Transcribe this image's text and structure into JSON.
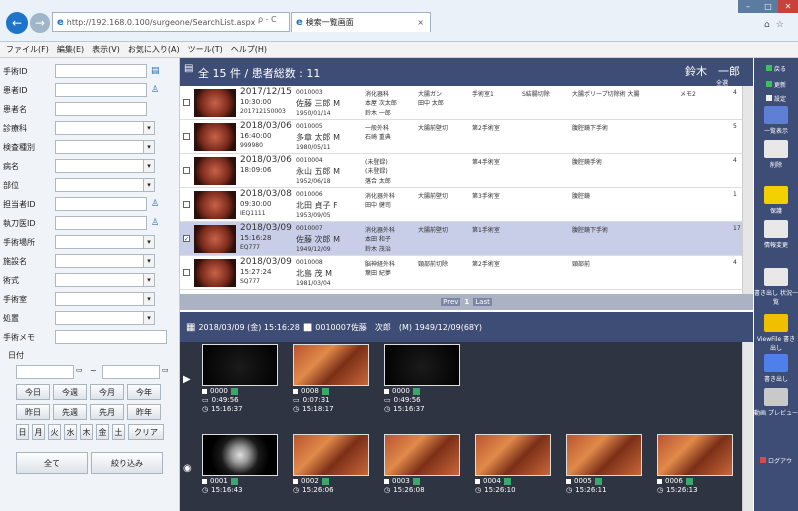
{
  "browser": {
    "url": "http://192.168.0.100/surgeone/SearchList.aspx",
    "addr_controls": "ρ - C",
    "tab_title": "検索一覧画面",
    "tab_close": "×"
  },
  "menu": [
    "ファイル(F)",
    "編集(E)",
    "表示(V)",
    "お気に入り(A)",
    "ツール(T)",
    "ヘルプ(H)"
  ],
  "search_form": {
    "fields": [
      {
        "label": "手術ID",
        "kind": "input",
        "icon": "search-list-icon"
      },
      {
        "label": "患者ID",
        "kind": "input",
        "icon": "person-icon"
      },
      {
        "label": "患者名",
        "kind": "input"
      },
      {
        "label": "診療科",
        "kind": "select"
      },
      {
        "label": "検査種別",
        "kind": "select"
      },
      {
        "label": "病名",
        "kind": "select"
      },
      {
        "label": "部位",
        "kind": "select"
      },
      {
        "label": "担当者ID",
        "kind": "input",
        "icon": "person-icon"
      },
      {
        "label": "執刀医ID",
        "kind": "input",
        "icon": "person-icon"
      },
      {
        "label": "手術場所",
        "kind": "select"
      },
      {
        "label": "施設名",
        "kind": "select"
      },
      {
        "label": "術式",
        "kind": "select"
      },
      {
        "label": "手術室",
        "kind": "select"
      },
      {
        "label": "処置",
        "kind": "select"
      },
      {
        "label": "手術メモ",
        "kind": "input"
      }
    ],
    "date_label": "日付",
    "date_sep": "~",
    "range_buttons": [
      "今日",
      "今週",
      "今月",
      "今年",
      "昨日",
      "先週",
      "先月",
      "昨年"
    ],
    "weekday_buttons": [
      "日",
      "月",
      "火",
      "水",
      "木",
      "金",
      "土"
    ],
    "clear_button": "クリア",
    "all_button": "全て",
    "filter_button": "絞り込み"
  },
  "list": {
    "summary": "全 15 件 / 患者総数 : 11",
    "user": "鈴木　一郎",
    "all_select": "全選",
    "rows": [
      {
        "date": "2017/12/15",
        "time": "10:30:00",
        "code": "201712150003",
        "pid": "0010003",
        "name": "佐藤 三郎 M",
        "dob": "1950/01/14",
        "dept": "消化器科",
        "s1": "本屋 次太郎",
        "s2": "鈴木 一郎",
        "c1": "大腸ガン",
        "c2": "田中 太郎",
        "c3": "手術室1",
        "c4": "S結腸切除",
        "c5": "大腸ポリープ切除術 大腸",
        "c6": "メモ2",
        "n": "4",
        "checked": false,
        "selected": false
      },
      {
        "date": "2018/03/06",
        "time": "16:40:00",
        "code": "999980",
        "pid": "0010005",
        "name": "多章 太郎 M",
        "dob": "1980/05/11",
        "dept": "一般外科",
        "s1": "石崎 重典",
        "s2": "",
        "c1": "大腸前壁切",
        "c2": "",
        "c3": "第2手術室",
        "c4": "",
        "c5": "腹腔鏡下手術",
        "c6": "",
        "n": "5",
        "checked": false,
        "selected": false
      },
      {
        "date": "2018/03/06",
        "time": "18:09:06",
        "code": "",
        "pid": "0010004",
        "name": "永山 五郎 M",
        "dob": "1952/06/18",
        "dept": "(未登録)",
        "s1": "(未登録)",
        "s2": "落合 太郎",
        "c1": "",
        "c2": "",
        "c3": "第4手術室",
        "c4": "",
        "c5": "腹腔鏡手術",
        "c6": "",
        "n": "4",
        "checked": false,
        "selected": false
      },
      {
        "date": "2018/03/08",
        "time": "09:30:00",
        "code": "IEQ1111",
        "pid": "0010006",
        "name": "北田 貞子 F",
        "dob": "1953/09/05",
        "dept": "消化器外科",
        "s1": "田中 健司",
        "s2": "",
        "c1": "大腸前壁切",
        "c2": "",
        "c3": "第3手術室",
        "c4": "",
        "c5": "腹腔鏡",
        "c6": "",
        "n": "1",
        "checked": false,
        "selected": false
      },
      {
        "date": "2018/03/09",
        "time": "15:16:28",
        "code": "EQ777",
        "pid": "0010007",
        "name": "佐藤 次郎 M",
        "dob": "1949/12/09",
        "dept": "消化器外科",
        "s1": "本田 和子",
        "s2": "鈴木 茂治",
        "c1": "大腸前壁切",
        "c2": "",
        "c3": "第1手術室",
        "c4": "",
        "c5": "腹腔鏡下手術",
        "c6": "",
        "n": "17",
        "checked": true,
        "selected": true
      },
      {
        "date": "2018/03/09",
        "time": "15:27:24",
        "code": "SQ777",
        "pid": "0010008",
        "name": "北島 茂 M",
        "dob": "1981/03/04",
        "dept": "脳神経外科",
        "s1": "葉田 紀夢",
        "s2": "",
        "c1": "頸部前切除",
        "c2": "",
        "c3": "第2手術室",
        "c4": "",
        "c5": "頸部前",
        "c6": "",
        "n": "4",
        "checked": false,
        "selected": false
      }
    ]
  },
  "pager": {
    "prev": "Prev",
    "page": "1",
    "next": "Last"
  },
  "detail": {
    "header": "2018/03/09 (金) 15:16:28",
    "patient": "0010007佐藤　次郎　(M) 1949/12/09(68Y)"
  },
  "media": {
    "videos": [
      {
        "id": "0000",
        "dur": "0:49:56",
        "time": "15:16:37",
        "img": "dark"
      },
      {
        "id": "0008",
        "dur": "0:07:31",
        "time": "15:18:17",
        "img": "tissue"
      },
      {
        "id": "0000",
        "dur": "0:49:56",
        "time": "15:16:37",
        "img": "dark"
      }
    ],
    "photos": [
      {
        "id": "0001",
        "time": "15:16:43",
        "img": "scope"
      },
      {
        "id": "0002",
        "time": "15:26:06",
        "img": "tissue"
      },
      {
        "id": "0003",
        "time": "15:26:08",
        "img": "tissue"
      },
      {
        "id": "0004",
        "time": "15:26:10",
        "img": "tissue"
      },
      {
        "id": "0005",
        "time": "15:26:11",
        "img": "tissue"
      },
      {
        "id": "0006",
        "time": "15:26:13",
        "img": "tissue"
      }
    ]
  },
  "right_bar": [
    {
      "label": "戻る",
      "icon": "back-icon"
    },
    {
      "label": "更新",
      "icon": "refresh-icon"
    },
    {
      "label": "設定",
      "icon": "settings-icon"
    },
    {
      "label": "一覧表示",
      "icon": "grid-view-icon"
    },
    {
      "label": "削除",
      "icon": "trash-icon"
    },
    {
      "label": "保護",
      "icon": "key-icon"
    },
    {
      "label": "情報変更",
      "icon": "edit-icon"
    },
    {
      "label": "書き出し 状況一覧",
      "icon": "export-status-icon"
    },
    {
      "label": "ViewFile 書き出し",
      "icon": "viewfile-icon"
    },
    {
      "label": "書き出し",
      "icon": "export-icon"
    },
    {
      "label": "動画 プレビュー",
      "icon": "video-preview-icon"
    },
    {
      "label": "ログアウ",
      "icon": "logout-icon"
    }
  ],
  "colors": {
    "accent": "#3d4d75",
    "selected_row": "#c8cde8",
    "close": "#c9413c"
  }
}
